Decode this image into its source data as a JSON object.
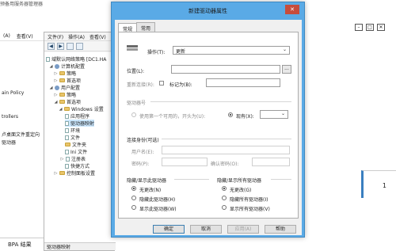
{
  "app": {
    "title": "预备用服务器管理器"
  },
  "bg_left": {
    "menu": [
      "(A)",
      "查看(V)"
    ],
    "snippets": [
      "ain Policy",
      "trollers",
      "卢桌面文件重定向",
      "驱动器"
    ]
  },
  "bpa": {
    "label": "BPA 结果"
  },
  "gpme": {
    "menu": [
      "文件(F)",
      "操作(A)",
      "查看(V)"
    ],
    "tree": [
      {
        "label": "域默认网络策略 [DC1.HA",
        "indent": 0,
        "icon": "doc"
      },
      {
        "label": "计算机配置",
        "indent": 1,
        "icon": "gear",
        "expanded": true
      },
      {
        "label": "策略",
        "indent": 2,
        "icon": "folder"
      },
      {
        "label": "首选项",
        "indent": 2,
        "icon": "folder"
      },
      {
        "label": "用户配置",
        "indent": 1,
        "icon": "gear",
        "expanded": true
      },
      {
        "label": "策略",
        "indent": 2,
        "icon": "folder"
      },
      {
        "label": "首选项",
        "indent": 2,
        "icon": "folder",
        "expanded": true
      },
      {
        "label": "Windows 设置",
        "indent": 3,
        "icon": "folder",
        "expanded": true
      },
      {
        "label": "应用程序",
        "indent": 4,
        "icon": "doc"
      },
      {
        "label": "驱动器映射",
        "indent": 4,
        "icon": "doc",
        "selected": true
      },
      {
        "label": "环境",
        "indent": 4,
        "icon": "doc"
      },
      {
        "label": "文件",
        "indent": 4,
        "icon": "doc"
      },
      {
        "label": "文件夹",
        "indent": 4,
        "icon": "folder"
      },
      {
        "label": "Ini 文件",
        "indent": 4,
        "icon": "doc"
      },
      {
        "label": "注册表",
        "indent": 4,
        "icon": "doc"
      },
      {
        "label": "快捷方式",
        "indent": 4,
        "icon": "doc"
      },
      {
        "label": "控制面板设置",
        "indent": 3,
        "icon": "folder"
      }
    ],
    "status": "驱动器映射"
  },
  "right": {
    "count": "1"
  },
  "dialog": {
    "title": "新建驱动器属性",
    "close": "✕",
    "tabs": [
      "常规",
      "常用"
    ],
    "action_label": "操作(T):",
    "action_value": "更新",
    "location_label": "位置(L):",
    "location_value": "",
    "browse": "...",
    "reconnect_label": "重新连接(R):",
    "label_as_label": "标记为(B):",
    "drive_letter_section": "驱动器号",
    "first_available_label": "使用第一个可用的，开头为(U):",
    "existing_label": "现有(X):",
    "connect_as_section": "连接身份(可选)",
    "username_label": "用户名(E):",
    "password_label": "密码(P):",
    "confirm_password_label": "确认密码(O):",
    "hide_drive_section": "隐藏/显示此驱动器",
    "hide_drive_options": [
      "无更改(N)",
      "隐藏此驱动器(H)",
      "显示此驱动器(W)"
    ],
    "hide_all_section": "隐藏/显示所有驱动器",
    "hide_all_options": [
      "无更改(G)",
      "隐藏所有驱动器(I)",
      "显示所有驱动器(V)"
    ],
    "buttons": {
      "ok": "确定",
      "cancel": "取消",
      "apply": "应用(A)",
      "help": "帮助"
    }
  }
}
